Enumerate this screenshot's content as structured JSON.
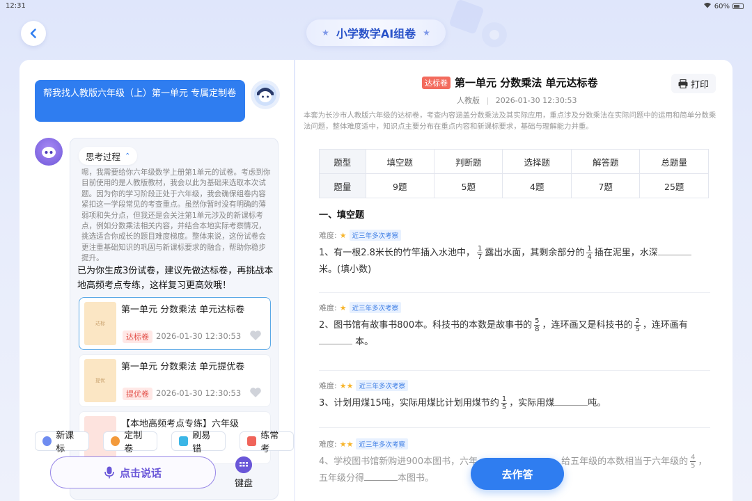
{
  "status_bar": {
    "time": "12:31",
    "battery": "60%"
  },
  "header": {
    "title": "小学数学AI组卷"
  },
  "chat": {
    "user_message": "帮我找人教版六年级（上）第一单元 专属定制卷",
    "thinking_label": "思考过程",
    "thinking_text": "嗯，我需要给你六年级数学上册第1单元的试卷。考虑到你目前使用的是人教版教材，我会以此为基础来选取本次试题。因为你的学习阶段正处于六年级，我会确保组卷内容紧扣这一学段常见的考查重点。虽然你暂时没有明确的薄弱项和失分点，但我还是会关注第1单元涉及的新课标考点，例如分数乘法相关内容，并结合本地实际考察情况，挑选适合你成长的题目难度梯度。整体来说，这份试卷会更注重基础知识的巩固与新课标要求的融合，帮助你稳步提升。",
    "answer_text": "已为你生成3份试卷，建议先做达标卷，再挑战本地高频考点专练，这样复习更高效哦！",
    "papers": [
      {
        "title": "第一单元 分数乘法 单元达标卷",
        "tag": "达标卷",
        "date": "2026-01-30 12:30:53",
        "thumb": "达标"
      },
      {
        "title": "第一单元 分数乘法 单元提优卷",
        "tag": "提优卷",
        "date": "2026-01-30 12:30:53",
        "thumb": "提优"
      },
      {
        "title": "【本地高频考点专练】六年级",
        "tag": "",
        "date": "",
        "thumb": ""
      }
    ]
  },
  "quick_actions": [
    {
      "label": "新课标",
      "color": "#6f8cf0"
    },
    {
      "label": "定制卷",
      "color": "#f39a3b"
    },
    {
      "label": "刷易错",
      "color": "#3bb6e6"
    },
    {
      "label": "练常考",
      "color": "#f0645a"
    }
  ],
  "input": {
    "voice_label": "点击说话",
    "keyboard_label": "键盘"
  },
  "doc": {
    "badge": "达标卷",
    "title": "第一单元 分数乘法 单元达标卷",
    "print_label": "打印",
    "publisher": "人教版",
    "date": "2026-01-30 12:30:53",
    "description": "本套为长沙市人教版六年级的达标卷，考查内容涵盖分数乘法及其实际应用，重点涉及分数乘法在实际问题中的运用和简单分数乘法问题，整体难度适中，知识点主要分布在重点内容和新课标要求，基础与理解能力并重。",
    "stats": {
      "headers": [
        "题型",
        "填空题",
        "判断题",
        "选择题",
        "解答题",
        "总题量"
      ],
      "values": [
        "题量",
        "9题",
        "5题",
        "4题",
        "7题",
        "25题"
      ]
    },
    "section_title": "一、填空题",
    "difficulty_label": "难度:",
    "hot_tag": "近三年多次考察",
    "questions": [
      {
        "stars": "★",
        "p1": "1、有一根2.8米长的竹竿插入水池中，",
        "f1n": "1",
        "f1d": "7",
        "p2": "露出水面，其剩余部分的",
        "f2n": "1",
        "f2d": "4",
        "p3": "插在泥里，水深",
        "p4": "米。(填小数)"
      },
      {
        "stars": "★",
        "p1": "2、图书馆有故事书800本。科技书的本数是故事书的",
        "f1n": "5",
        "f1d": "8",
        "p2": "，连环画又是科技书的",
        "f2n": "2",
        "f2d": "5",
        "p3": "，连环画有",
        "p4": "本。"
      },
      {
        "stars": "★★",
        "p1": "3、计划用煤15吨，实际用煤比计划用煤节约",
        "f1n": "1",
        "f1d": "5",
        "p2": "，实际用煤",
        "p3": "吨。"
      },
      {
        "stars": "★★",
        "p1": "4、学校图书馆新购进900本图书，六年",
        "p2": "给五年级的本数相当于六年级的",
        "f1n": "4",
        "f1d": "5",
        "p3": "，",
        "p4": "五年级分得",
        "p5": "本图书。"
      }
    ],
    "go_label": "去作答"
  },
  "colors": {
    "accent": "#2f7df0",
    "voice": "#6a57d8",
    "tag_red": "#f36b5d",
    "star": "#f7b52c"
  }
}
